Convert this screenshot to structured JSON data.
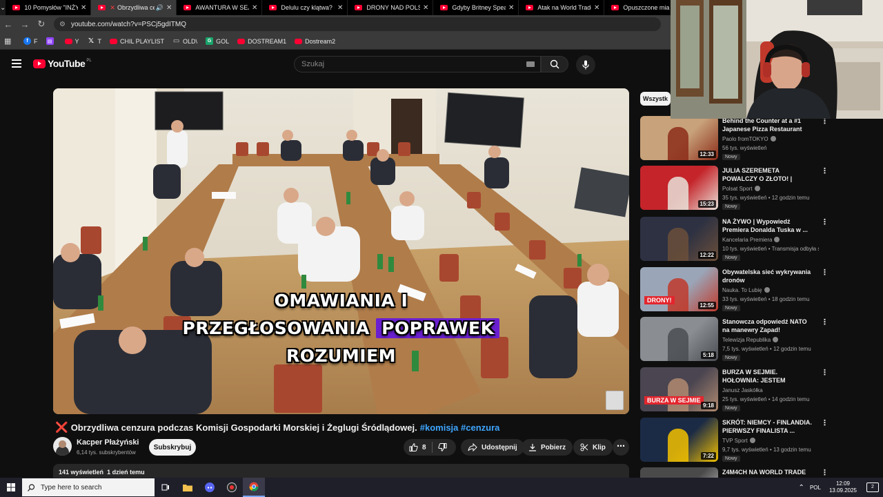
{
  "browser": {
    "tabs": [
      {
        "title": "10 Pomysłów \"INŻYNI",
        "active": false
      },
      {
        "title": "Obrzydliwa cenz",
        "active": true
      },
      {
        "title": "AWANTURA W SEJMI",
        "active": false
      },
      {
        "title": "Delulu czy klątwa? - W",
        "active": false
      },
      {
        "title": "DRONY NAD POLSKĄ",
        "active": false
      },
      {
        "title": "Gdyby Britney Spears",
        "active": false
      },
      {
        "title": "Atak na World Trade",
        "active": false
      },
      {
        "title": "Opuszczone mia",
        "active": false
      }
    ],
    "url": "youtube.com/watch?v=PSCj5gdITMQ",
    "bookmarks": [
      {
        "label": "F",
        "icon": "facebook-icon"
      },
      {
        "label": "",
        "icon": "twitch-icon"
      },
      {
        "label": "Y",
        "icon": "youtube-icon"
      },
      {
        "label": "T",
        "icon": "x-icon"
      },
      {
        "label": "CHIL PLAYLIST",
        "icon": "youtube-icon"
      },
      {
        "label": "OLD\\",
        "icon": "folder-icon"
      },
      {
        "label": "GOL",
        "icon": "gol-icon"
      },
      {
        "label": "DOSTREAM1",
        "icon": "youtube-icon"
      },
      {
        "label": "Dostream2",
        "icon": "youtube-icon"
      }
    ]
  },
  "youtube": {
    "logo_text": "YouTube",
    "country": "PL",
    "search_placeholder": "Szukaj",
    "video": {
      "subtitle_line1": "OMAWIANIA I",
      "subtitle_line2a": "PRZEGŁOSOWANIA",
      "subtitle_line2b": "POPRAWEK",
      "subtitle_line3": "ROZUMIEM",
      "title_prefix": "❌",
      "title": "Obrzydliwa cenzura podczas Komisji Gospodarki Morskiej i Żeglugi Śródlądowej.",
      "tags": "#komisja #cenzura",
      "channel_name": "Kacper Płażyński",
      "channel_subs": "6,14 tys. subskrybentów",
      "subscribe_label": "Subskrybuj",
      "likes": "8",
      "share_label": "Udostępnij",
      "download_label": "Pobierz",
      "clip_label": "Klip",
      "views": "141 wyświetleń",
      "uploaded": "1 dzień temu"
    },
    "chip_label": "Wszystk",
    "recommendations": [
      {
        "title": "Behind the Counter at a #1 Japanese Pizza Restaurant",
        "channel": "Paolo fromTOKYO",
        "meta": "56 tys. wyświetleń",
        "duration": "12:33",
        "badge": "Nowy",
        "verified": true
      },
      {
        "title": "JULIA SZEREMETA POWALCZY O ZŁOTO! | POLKA W FINALE ...",
        "channel": "Polsat Sport",
        "meta": "35 tys. wyświetleń • 12 godzin temu",
        "duration": "15:23",
        "badge": "Nowy",
        "verified": true
      },
      {
        "title": "NA ŻYWO | Wypowiedź Premiera Donalda Tuska w ...",
        "channel": "Kancelaria Premiera",
        "meta": "10 tys. wyświetleń • Transmisja odbyła s...",
        "duration": "12:22",
        "badge": "Nowy",
        "verified": true
      },
      {
        "title": "Obywatelska sieć wykrywania dronów",
        "channel": "Nauka. To Lubię",
        "meta": "33 tys. wyświetleń • 18 godzin temu",
        "duration": "12:55",
        "badge": "Nowy",
        "verified": true,
        "thumb_text": "DRONY!"
      },
      {
        "title": "Stanowcza odpowiedź NATO na manewry Zapad!",
        "channel": "Telewizja Republika",
        "meta": "7,5 tys. wyświetleń • 12 godzin temu",
        "duration": "5:18",
        "badge": "Nowy",
        "verified": true
      },
      {
        "title": "BURZA W SEJMIE. HOŁOWNIA: JESTEM ZDUMIONY!",
        "channel": "Janusz Jaskółka",
        "meta": "25 tys. wyświetleń • 14 godzin temu",
        "duration": "9:18",
        "badge": "Nowy",
        "verified": false,
        "thumb_text": "BURZA W SEJMIE"
      },
      {
        "title": "SKRÓT: NIEMCY - FINLANDIA. PIERWSZY FINALISTA ...",
        "channel": "TVP Sport",
        "meta": "9,7 tys. wyświetleń • 13 godzin temu",
        "duration": "7:22",
        "badge": "Nowy",
        "verified": true
      },
      {
        "title": "Z4M4CH NA WORLD TRADE",
        "channel": "",
        "meta": "",
        "duration": "",
        "badge": "",
        "verified": false
      }
    ]
  },
  "taskbar": {
    "search_placeholder": "Type here to search",
    "language": "POL",
    "time": "12:09",
    "date": "13.09.2025",
    "notifications": "2"
  }
}
